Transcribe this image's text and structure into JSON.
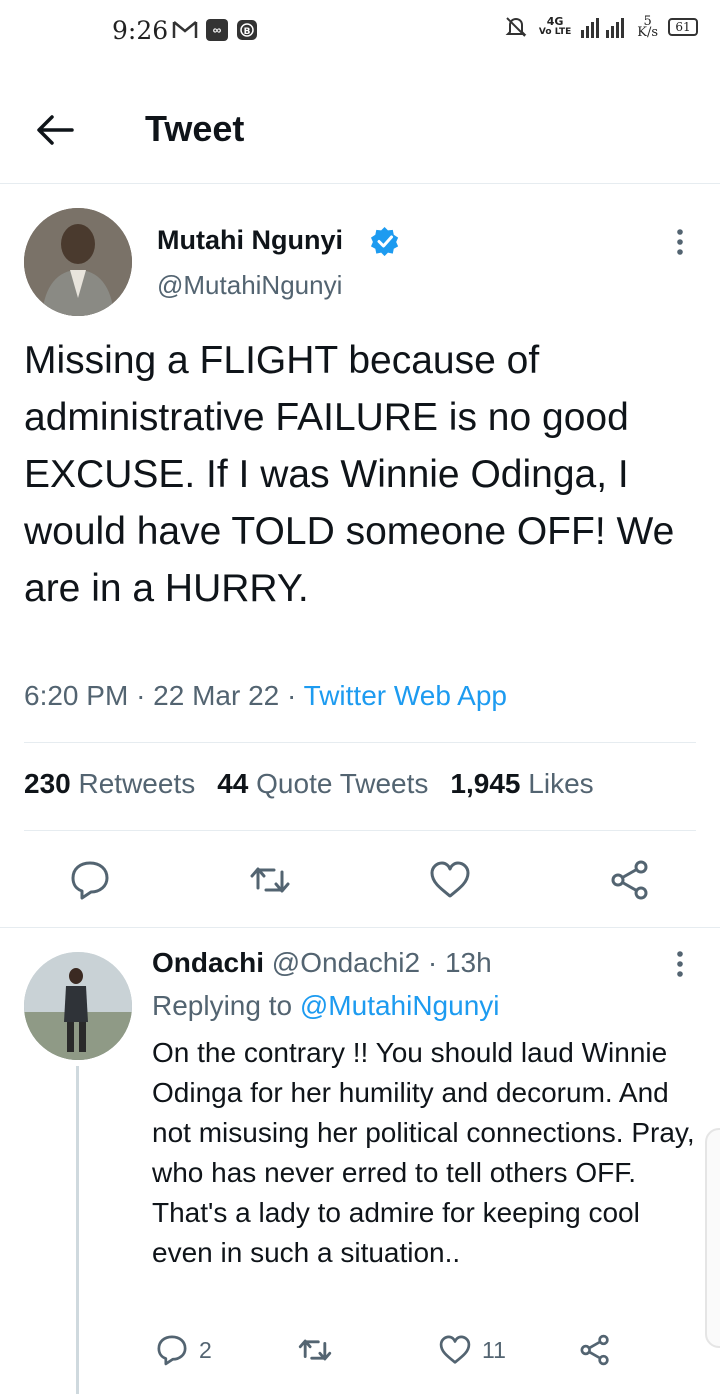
{
  "status_bar": {
    "time": "9:26",
    "network_label": "4G",
    "volte_label": "Vo LTE",
    "speed_value": "5",
    "speed_unit": "K/s",
    "battery": "61"
  },
  "header": {
    "title": "Tweet"
  },
  "tweet": {
    "author_name": "Mutahi Ngunyi",
    "author_handle": "@MutahiNgunyi",
    "text": "Missing a FLIGHT because of administrative FAILURE is no good EXCUSE. If I was Winnie Odinga, I would have TOLD someone OFF! We are in a HURRY.",
    "time": "6:20 PM",
    "date": "22 Mar 22",
    "source": "Twitter Web App",
    "retweets_count": "230",
    "retweets_label": "Retweets",
    "quotes_count": "44",
    "quotes_label": "Quote Tweets",
    "likes_count": "1,945",
    "likes_label": "Likes"
  },
  "reply": {
    "author_name": "Ondachi",
    "author_handle": "@Ondachi2",
    "age": "13h",
    "replying_prefix": "Replying to",
    "replying_to": "@MutahiNgunyi",
    "text": "On the contrary !! You should laud Winnie Odinga for her humility and decorum. And not misusing her political connections. Pray, who has never erred to tell others OFF.  That's a lady to admire for keeping cool even in such a situation..",
    "reply_count": "2",
    "like_count": "11"
  },
  "colors": {
    "accent": "#1d9bf0",
    "secondary_text": "#536471",
    "primary_text": "#0f1419",
    "divider": "#e6ecf0"
  }
}
